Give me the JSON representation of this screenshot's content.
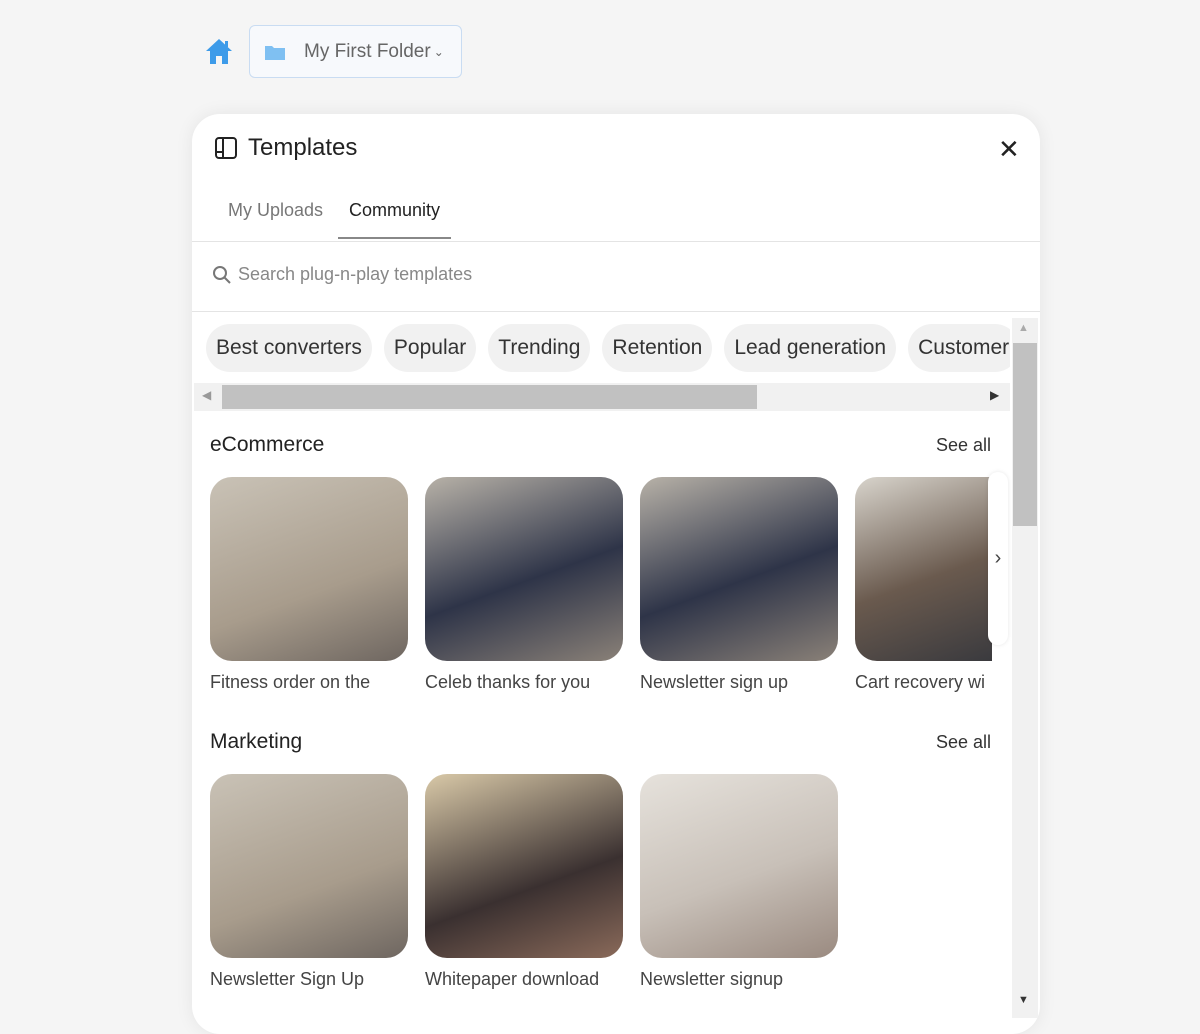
{
  "breadcrumb": {
    "folder_label": "My First Folder"
  },
  "panel": {
    "title": "Templates",
    "tabs": [
      {
        "label": "My Uploads"
      },
      {
        "label": "Community",
        "active": true
      }
    ],
    "search_placeholder": "Search plug-n-play templates",
    "chips": [
      "Best converters",
      "Popular",
      "Trending",
      "Retention",
      "Lead generation",
      "Customer"
    ],
    "sections": [
      {
        "title": "eCommerce",
        "see_all": "See all",
        "items": [
          "Fitness order on the",
          "Celeb thanks for you",
          "Newsletter sign up",
          "Cart recovery wi"
        ]
      },
      {
        "title": "Marketing",
        "see_all": "See all",
        "items": [
          "Newsletter Sign Up",
          "Whitepaper download",
          "Newsletter signup"
        ]
      }
    ]
  },
  "colors": {
    "accent": "#3d9be9"
  }
}
